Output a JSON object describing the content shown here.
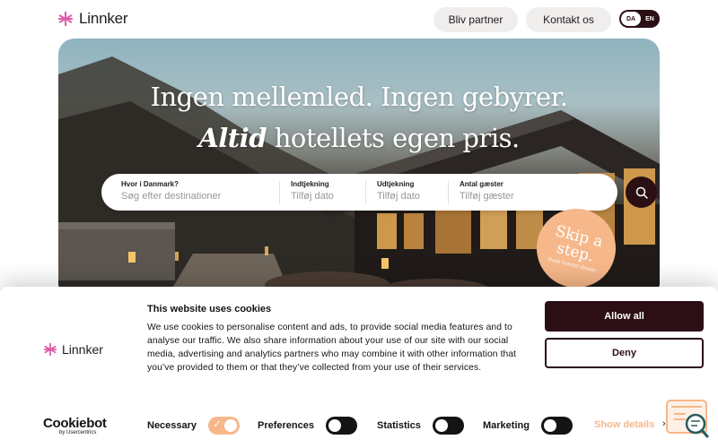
{
  "header": {
    "logo_text": "Linnker",
    "nav": {
      "partner_label": "Bliv partner",
      "contact_label": "Kontakt os"
    },
    "lang": {
      "active": "DA",
      "other": "EN"
    }
  },
  "hero": {
    "title_line1": "Ingen mellemled. Ingen gebyrer.",
    "title_line2_em": "Altid",
    "title_line2_rest": " hotellets egen pris.",
    "badge_title": "Skip a step.",
    "badge_sub": "Book hotellet direkte"
  },
  "search": {
    "destination": {
      "label": "Hvor i Danmark?",
      "placeholder": "Søg efter destinationer"
    },
    "checkin": {
      "label": "Indtjekning",
      "placeholder": "Tilføj dato"
    },
    "checkout": {
      "label": "Udtjekning",
      "placeholder": "Tilføj dato"
    },
    "guests": {
      "label": "Antal gæster",
      "placeholder": "Tilføj gæster"
    }
  },
  "cookie": {
    "title": "This website uses cookies",
    "body": "We use cookies to personalise content and ads, to provide social media features and to analyse our traffic. We also share information about your use of our site with our social media, advertising and analytics partners who may combine it with other information that you’ve provided to them or that they’ve collected from your use of their services.",
    "allow_all": "Allow all",
    "deny": "Deny",
    "logo_text": "Linnker",
    "cookiebot_logo": "Cookiebot",
    "cookiebot_sub": "by Usercentrics",
    "toggles": [
      {
        "label": "Necessary",
        "state": "on"
      },
      {
        "label": "Preferences",
        "state": "off"
      },
      {
        "label": "Statistics",
        "state": "off"
      },
      {
        "label": "Marketing",
        "state": "off"
      }
    ],
    "show_details": "Show details"
  },
  "colors": {
    "brand_dark": "#2b0f14",
    "accent_peach": "#f6b78a",
    "logo_pink": "#e05ba8"
  }
}
